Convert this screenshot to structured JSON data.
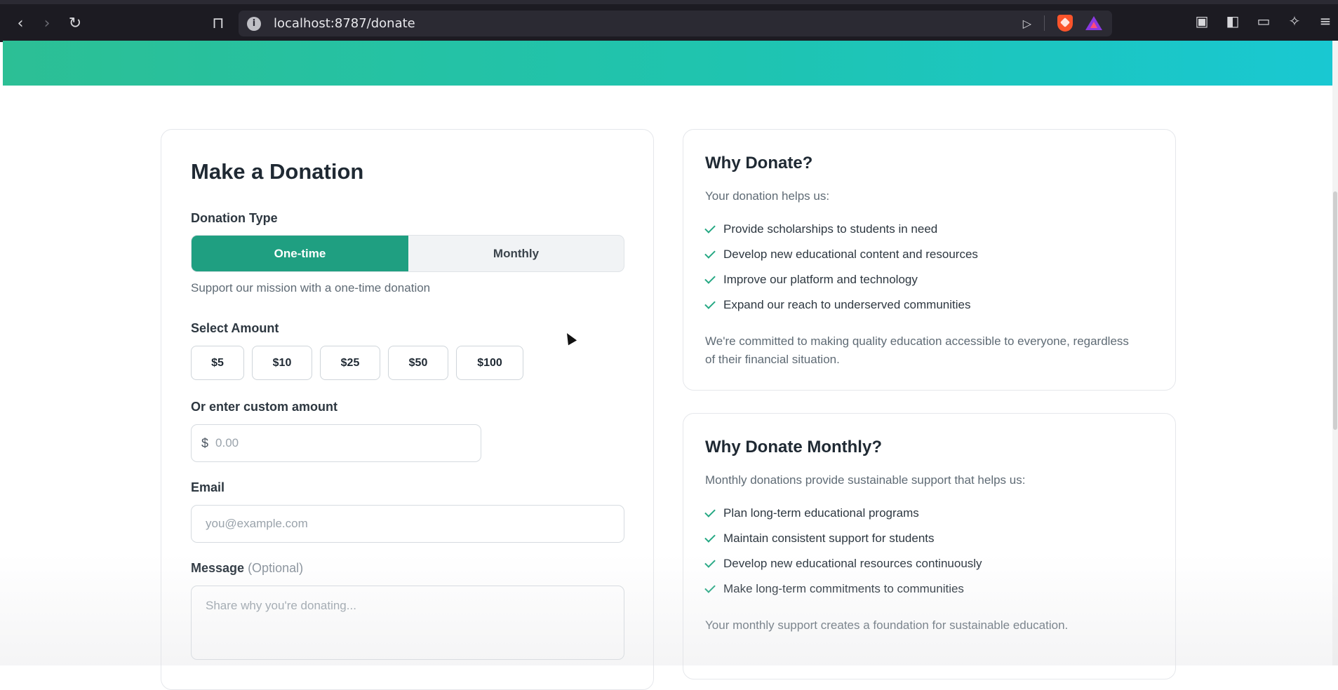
{
  "browser": {
    "url": "localhost:8787/donate",
    "info_icon": "i"
  },
  "donation_form": {
    "title": "Make a Donation",
    "donation_type_label": "Donation Type",
    "toggle": {
      "one_time": "One-time",
      "monthly": "Monthly",
      "selected": "One-time"
    },
    "helper_text": "Support our mission with a one-time donation",
    "select_amount_label": "Select Amount",
    "amounts": [
      "$5",
      "$10",
      "$25",
      "$50",
      "$100"
    ],
    "custom_amount_label": "Or enter custom amount",
    "currency_symbol": "$",
    "custom_amount_placeholder": "0.00",
    "email_label": "Email",
    "email_placeholder": "you@example.com",
    "message_label": "Message",
    "message_optional": "(Optional)",
    "message_placeholder": "Share why you're donating..."
  },
  "why_donate": {
    "title": "Why Donate?",
    "intro": "Your donation helps us:",
    "items": [
      "Provide scholarships to students in need",
      "Develop new educational content and resources",
      "Improve our platform and technology",
      "Expand our reach to underserved communities"
    ],
    "note": "We're committed to making quality education accessible to everyone, regardless of their financial situation."
  },
  "why_donate_monthly": {
    "title": "Why Donate Monthly?",
    "intro": "Monthly donations provide sustainable support that helps us:",
    "items": [
      "Plan long-term educational programs",
      "Maintain consistent support for students",
      "Develop new educational resources continuously",
      "Make long-term commitments to communities"
    ],
    "note": "Your monthly support creates a foundation for sustainable education."
  },
  "colors": {
    "accent": "#1f9f81",
    "check": "#25a883",
    "gradient_start": "#2cbf95",
    "gradient_end": "#19c8d2"
  }
}
